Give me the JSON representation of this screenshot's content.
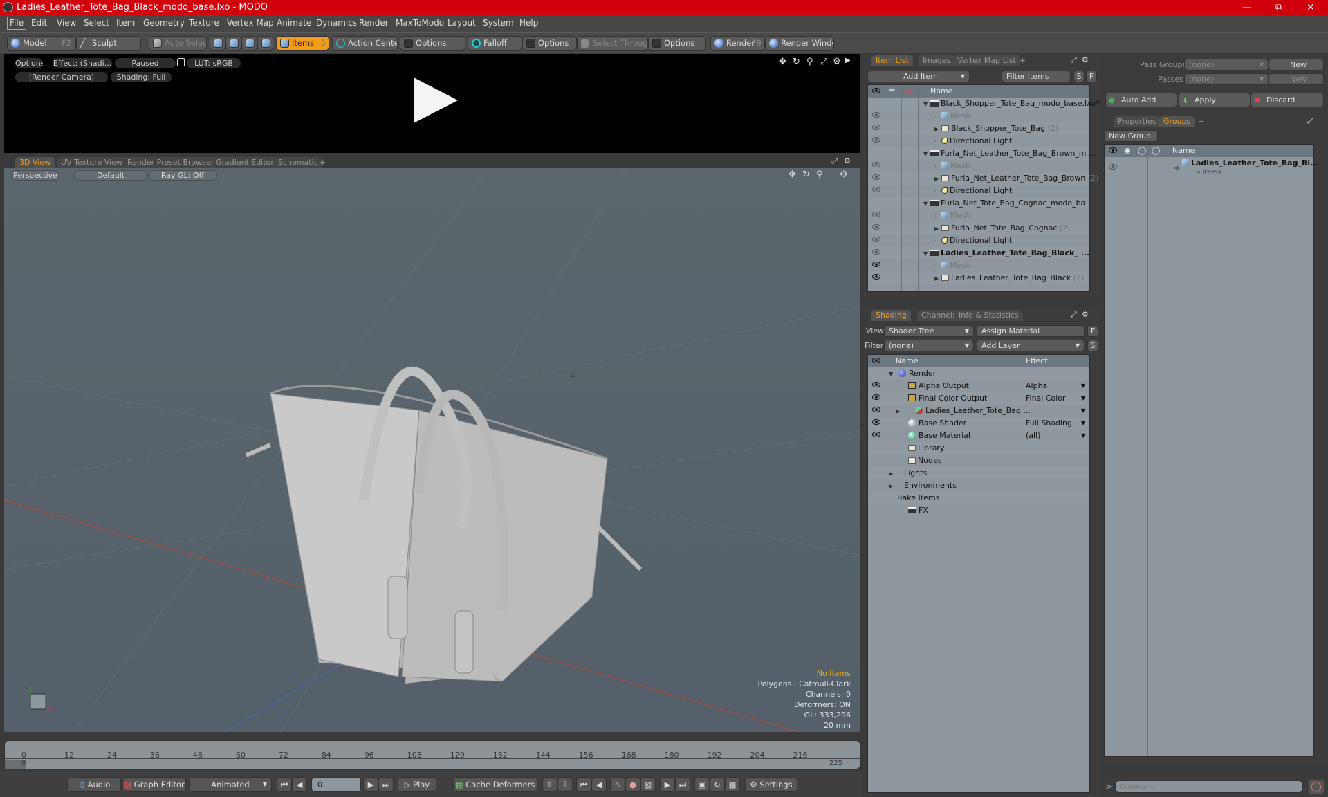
{
  "window": {
    "title": "Ladies_Leather_Tote_Bag_Black_modo_base.lxo - MODO",
    "controls": [
      "minimize",
      "restore",
      "close"
    ]
  },
  "menu": [
    "File",
    "Edit",
    "View",
    "Select",
    "Item",
    "Geometry",
    "Texture",
    "Vertex Map",
    "Animate",
    "Dynamics",
    "Render",
    "MaxToModo",
    "Layout",
    "System",
    "Help"
  ],
  "toolbar": {
    "model": "Model",
    "model_key": "F2",
    "sculpt": "Sculpt",
    "auto_select": "Auto Select",
    "items": "Items",
    "items_key": "5",
    "action_center": "Action Center",
    "options1": "Options",
    "falloff": "Falloff",
    "options2": "Options",
    "select_through": "Select Through",
    "options3": "Options",
    "render": "Render",
    "render_key": "F9",
    "render_window": "Render Window"
  },
  "render_preview": {
    "options": "Options",
    "effect": "Effect: (Shadi...",
    "status": "Paused",
    "lut": "LUT: sRGB",
    "camera": "(Render Camera)",
    "shading": "Shading: Full"
  },
  "viewport_tabs": [
    {
      "label": "3D View",
      "active": true
    },
    {
      "label": "UV Texture View"
    },
    {
      "label": "Render Preset Browser"
    },
    {
      "label": "Gradient Editor"
    },
    {
      "label": "Schematic"
    }
  ],
  "viewport": {
    "projection": "Perspective",
    "style": "Default",
    "raygl": "Ray GL: Off",
    "stats": {
      "selection": "No Items",
      "polygons": "Polygons : Catmull-Clark",
      "channels": "Channels: 0",
      "deformers": "Deformers: ON",
      "gl": "GL: 333,296",
      "grid": "20 mm"
    },
    "axis_label": "Z"
  },
  "timeline": {
    "ticks": [
      "0",
      "12",
      "24",
      "36",
      "48",
      "60",
      "72",
      "84",
      "96",
      "108",
      "120",
      "132",
      "144",
      "156",
      "168",
      "180",
      "192",
      "204",
      "216"
    ],
    "range_start": "0",
    "range_end": "225",
    "current_frame_fraction": 0
  },
  "bottombar": {
    "audio": "Audio",
    "graph_editor": "Graph Editor",
    "animated": "Animated",
    "frame": "0",
    "play": "Play",
    "cache_deformers": "Cache Deformers",
    "settings": "Settings"
  },
  "item_list": {
    "tabs": [
      {
        "label": "Item List",
        "active": true
      },
      {
        "label": "Images"
      },
      {
        "label": "Vertex Map List"
      }
    ],
    "add_item": "Add Item",
    "filter_placeholder": "Filter Items",
    "s": "S",
    "f": "F",
    "column_name": "Name",
    "rows": [
      {
        "type": "scene",
        "label": "Black_Shopper_Tote_Bag_modo_base.lxo*",
        "indent": 0,
        "expanded": true,
        "eye": false
      },
      {
        "type": "mesh",
        "label": "Mesh",
        "indent": 1,
        "eye": true,
        "dim": true
      },
      {
        "type": "group",
        "label": "Black_Shopper_Tote_Bag",
        "count": "(2)",
        "indent": 1,
        "eye": true
      },
      {
        "type": "light",
        "label": "Directional Light",
        "indent": 1,
        "eye": true
      },
      {
        "type": "scene",
        "label": "Furla_Net_Leather_Tote_Bag_Brown_m ...",
        "indent": 0,
        "expanded": true,
        "eye": false
      },
      {
        "type": "mesh",
        "label": "Mesh",
        "indent": 1,
        "eye": true,
        "dim": true
      },
      {
        "type": "group",
        "label": "Furla_Net_Leather_Tote_Bag_Brown",
        "count": "(2)",
        "indent": 1,
        "eye": true
      },
      {
        "type": "light",
        "label": "Directional Light",
        "indent": 1,
        "eye": true
      },
      {
        "type": "scene",
        "label": "Furla_Net_Tote_Bag_Cognac_modo_ba ...",
        "indent": 0,
        "expanded": true,
        "eye": false
      },
      {
        "type": "mesh",
        "label": "Mesh",
        "indent": 1,
        "eye": true,
        "dim": true
      },
      {
        "type": "group",
        "label": "Furla_Net_Tote_Bag_Cognac",
        "count": "(2)",
        "indent": 1,
        "eye": true
      },
      {
        "type": "light",
        "label": "Directional Light",
        "indent": 1,
        "eye": true
      },
      {
        "type": "scene",
        "label": "Ladies_Leather_Tote_Bag_Black_ ...",
        "indent": 0,
        "expanded": true,
        "eye": true,
        "bold": true
      },
      {
        "type": "mesh",
        "label": "Mesh",
        "indent": 1,
        "eye": true,
        "dim": true,
        "dark": true
      },
      {
        "type": "group",
        "label": "Ladies_Leather_Tote_Bag_Black",
        "count": "(2)",
        "indent": 1,
        "eye": true,
        "dark": true
      }
    ]
  },
  "shading": {
    "tabs": [
      {
        "label": "Shading",
        "active": true
      },
      {
        "label": "Channels"
      },
      {
        "label": "Info & Statistics"
      }
    ],
    "view_label": "View",
    "view_value": "Shader Tree",
    "assign_material": "Assign Material",
    "f": "F",
    "filter_label": "Filter",
    "filter_value": "(none)",
    "add_layer": "Add Layer",
    "s": "S",
    "col_name": "Name",
    "col_effect": "Effect",
    "rows": [
      {
        "label": "Render",
        "effect": "",
        "icon": "render-sphere",
        "indent": 0,
        "eye": false
      },
      {
        "label": "Alpha Output",
        "effect": "Alpha",
        "icon": "output",
        "indent": 1,
        "eye": true
      },
      {
        "label": "Final Color Output",
        "effect": "Final Color",
        "icon": "output",
        "indent": 1,
        "eye": true
      },
      {
        "label": "Ladies_Leather_Tote_Bag ...",
        "effect": "",
        "icon": "material-group",
        "indent": 1,
        "eye": true
      },
      {
        "label": "Base Shader",
        "effect": "Full Shading",
        "icon": "shader",
        "indent": 1,
        "eye": true
      },
      {
        "label": "Base Material",
        "effect": "(all)",
        "icon": "material",
        "indent": 1,
        "eye": true
      },
      {
        "label": "Library",
        "icon": "folder",
        "indent": 1
      },
      {
        "label": "Nodes",
        "icon": "folder",
        "indent": 1
      },
      {
        "label": "Lights",
        "icon": "none",
        "indent": 0,
        "arrow": true
      },
      {
        "label": "Environments",
        "icon": "none",
        "indent": 0,
        "arrow": true
      },
      {
        "label": "Bake Items",
        "icon": "none",
        "indent": 0
      },
      {
        "label": "FX",
        "icon": "clapper",
        "indent": 1
      }
    ]
  },
  "passes": {
    "pass_groups_label": "Pass Groups",
    "pass_groups_value": "(none)",
    "new1": "New",
    "passes_label": "Passes",
    "passes_value": "(none)",
    "new2": "New",
    "auto_add": "Auto Add",
    "apply": "Apply",
    "discard": "Discard"
  },
  "groups": {
    "tabs": [
      {
        "label": "Properties"
      },
      {
        "label": "Groups",
        "active": true
      }
    ],
    "new_group": "New Group",
    "col_name": "Name",
    "rows": [
      {
        "label": "Ladies_Leather_Tote_Bag_Bl...",
        "sub": "9 Items"
      }
    ]
  },
  "command": {
    "placeholder": "Command"
  }
}
